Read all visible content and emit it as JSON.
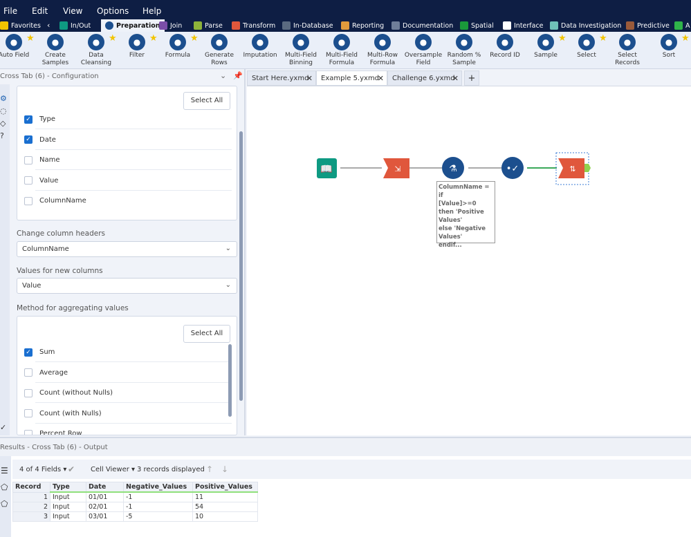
{
  "menu": [
    "File",
    "Edit",
    "View",
    "Options",
    "Help"
  ],
  "categories": [
    {
      "label": "Favorites",
      "color": "#f2c400"
    },
    {
      "label": "In/Out",
      "color": "#0e9a82"
    },
    {
      "label": "Preparation",
      "color": "#1c4f8e"
    },
    {
      "label": "Join",
      "color": "#7b4ea8"
    },
    {
      "label": "Parse",
      "color": "#8db33a"
    },
    {
      "label": "Transform",
      "color": "#e0573c"
    },
    {
      "label": "In-Database",
      "color": "#5a6a80"
    },
    {
      "label": "Reporting",
      "color": "#e09a3c"
    },
    {
      "label": "Documentation",
      "color": "#6f7e99"
    },
    {
      "label": "Spatial",
      "color": "#1a9a3a"
    },
    {
      "label": "Interface",
      "color": "#ffffff"
    },
    {
      "label": "Data Investigation",
      "color": "#6fc0b8"
    },
    {
      "label": "Predictive",
      "color": "#9a5a3a"
    },
    {
      "label": "A",
      "color": "#2fb34a"
    }
  ],
  "tools": [
    "Auto Field",
    "Create Samples",
    "Data Cleansing",
    "Filter",
    "Formula",
    "Generate Rows",
    "Imputation",
    "Multi-Field Binning",
    "Multi-Field Formula",
    "Multi-Row Formula",
    "Oversample Field",
    "Random % Sample",
    "Record ID",
    "Sample",
    "Select",
    "Select Records",
    "Sort"
  ],
  "config": {
    "title": "Cross Tab (6) - Configuration",
    "select_all": "Select All",
    "group_fields": [
      {
        "label": "Type",
        "checked": true
      },
      {
        "label": "Date",
        "checked": true
      },
      {
        "label": "Name",
        "checked": false
      },
      {
        "label": "Value",
        "checked": false
      },
      {
        "label": "ColumnName",
        "checked": false
      }
    ],
    "headers_label": "Change column headers",
    "headers_value": "ColumnName",
    "values_label": "Values for new columns",
    "values_value": "Value",
    "method_label": "Method for aggregating values",
    "methods": [
      {
        "label": "Sum",
        "checked": true
      },
      {
        "label": "Average",
        "checked": false
      },
      {
        "label": "Count (without Nulls)",
        "checked": false
      },
      {
        "label": "Count (with Nulls)",
        "checked": false
      },
      {
        "label": "Percent Row",
        "checked": false
      }
    ]
  },
  "doc_tabs": [
    "Start Here.yxmd",
    "Example 5.yxmd",
    "Challenge 6.yxmd"
  ],
  "annotation": "ColumnName = if\n[Value]>=0\nthen 'Positive\nValues'\nelse 'Negative\nValues'\nendif...",
  "results": {
    "title": "Results - Cross Tab (6) - Output",
    "fields": "4 of 4 Fields",
    "viewer": "Cell Viewer",
    "count": "3 records displayed",
    "columns": [
      "Record",
      "Type",
      "Date",
      "Negative_Values",
      "Positive_Values"
    ],
    "rows": [
      [
        "1",
        "Input",
        "01/01",
        "-1",
        "11"
      ],
      [
        "2",
        "Input",
        "02/01",
        "-1",
        "54"
      ],
      [
        "3",
        "Input",
        "03/01",
        "-5",
        "10"
      ]
    ]
  }
}
